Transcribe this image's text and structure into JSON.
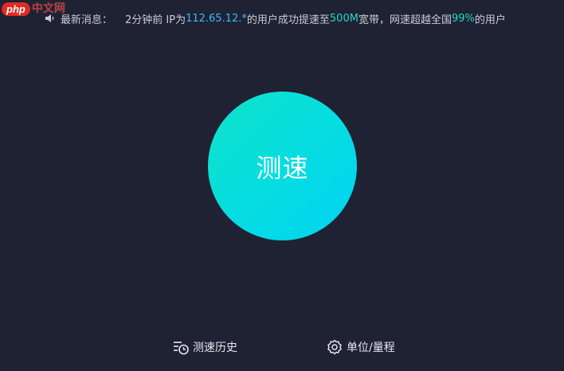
{
  "logo": {
    "php": "php",
    "cn": "中文网"
  },
  "notice": {
    "icon": "speaker-icon",
    "label": "最新消息：",
    "prefix": "2分钟前 IP为",
    "ip": "112.65.12.*",
    "mid": "的用户成功提速至",
    "speed": "500M",
    "mid2": "宽带，网速超越全国",
    "percent": "99%",
    "suffix": "的用户"
  },
  "main": {
    "speed_test_label": "测速"
  },
  "footer": {
    "history_label": "测速历史",
    "history_icon": "history-icon",
    "unit_label": "单位/量程",
    "unit_icon": "gear-icon"
  },
  "colors": {
    "background": "#1f2233",
    "accent_cyan": "#06dde0",
    "highlight_blue": "#3fb6ff",
    "highlight_teal": "#23d8c8"
  }
}
